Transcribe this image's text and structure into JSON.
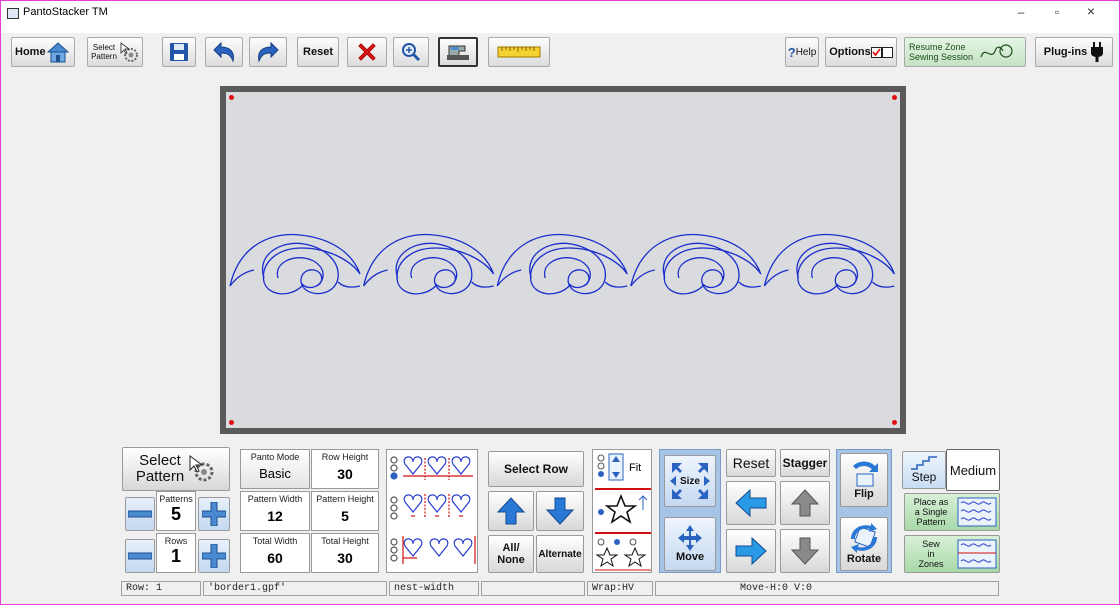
{
  "window": {
    "title": "PantoStacker TM",
    "minimize": "–",
    "maximize": "▫",
    "close": "×"
  },
  "toolbar": {
    "home": "Home",
    "select_pattern_line1": "Select",
    "select_pattern_line2": "Pattern",
    "reset": "Reset",
    "help": "Help",
    "options": "Options",
    "resume_line1": "Resume Zone",
    "resume_line2": "Sewing Session",
    "plugins": "Plug-ins"
  },
  "panel": {
    "select_pattern_line1": "Select",
    "select_pattern_line2": "Pattern",
    "patterns_label": "Patterns",
    "patterns_value": "5",
    "rows_label": "Rows",
    "rows_value": "1",
    "panto_mode_label": "Panto Mode",
    "panto_mode_value": "Basic",
    "row_height_label": "Row Height",
    "row_height_value": "30",
    "pattern_width_label": "Pattern Width",
    "pattern_width_value": "12",
    "pattern_height_label": "Pattern Height",
    "pattern_height_value": "5",
    "total_width_label": "Total Width",
    "total_width_value": "60",
    "total_height_label": "Total Height",
    "total_height_value": "30",
    "select_row": "Select Row",
    "all_none_line1": "All/",
    "all_none_line2": "None",
    "alternate": "Alternate",
    "fit": "Fit",
    "size": "Size",
    "move": "Move",
    "reset": "Reset",
    "stagger": "Stagger",
    "flip": "Flip",
    "rotate": "Rotate",
    "step": "Step",
    "medium": "Medium",
    "place_single_line1": "Place as",
    "place_single_line2": "a Single",
    "place_single_line3": "Pattern",
    "sew_zones_line1": "Sew",
    "sew_zones_line2": "in",
    "sew_zones_line3": "Zones"
  },
  "status": {
    "row": "Row: 1",
    "file": "'border1.gpf'",
    "mode": "nest-width",
    "wrap": "Wrap:HV",
    "move": "Move-H:0 V:0"
  },
  "colors": {
    "pattern_stroke": "#1a2ecc",
    "canvas": "#d9dbdf",
    "frame": "#5a5a5a",
    "accent_blue": "#a6c4e6"
  }
}
